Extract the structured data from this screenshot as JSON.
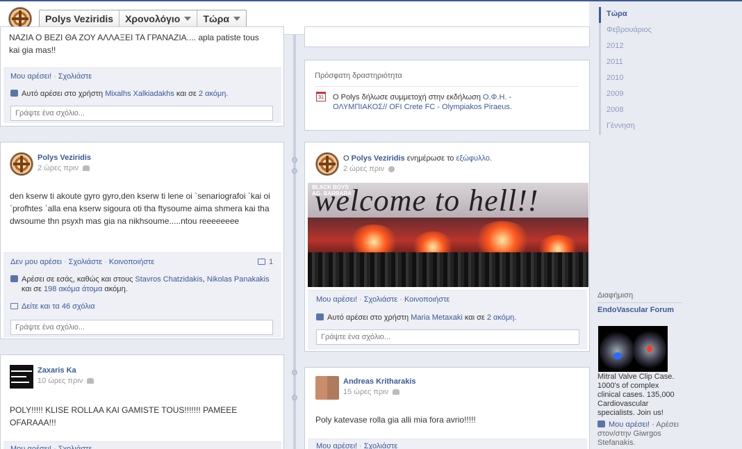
{
  "header": {
    "profile_name": "Polys Veziridis",
    "timeline_label": "Χρονολόγιο",
    "now_label": "Τώρα"
  },
  "common": {
    "like": "Μου αρέσει!",
    "unlike": "Δεν μου αρέσει",
    "comment": "Σχολιάστε",
    "share": "Κοινοποιήστε",
    "sep": "·",
    "comment_placeholder": "Γράψτε ένα σχόλιο..."
  },
  "post_top_left": {
    "text_line1": "NAZIA O BEZI ΘΑ ΖΟΥ ΑΛΛΑΞΕΙ ΤΑ ΓΡΑΝΑΖΙΑ.... apla patiste tous",
    "text_line2": "kai gia mas!!",
    "likes_prefix": "Αυτό αρέσει στο χρήστη",
    "likes_user": "Mixalhs Xalkiadakhs",
    "likes_and": "και σε",
    "likes_more": "2 ακόμη."
  },
  "recent_activity": {
    "title": "Πρόσφατη δραστηριότητα",
    "calendar_day": "31",
    "text_prefix": "Ο Polys δήλωσε συμμετοχή στην εκδήλωση",
    "event_line1": "Ο.Φ.Η. -",
    "event_line2": "ΟΛΥΜΠΙΑΚΟΣ// OFI Crete FC - Olympiakos Piraeus."
  },
  "post_polys": {
    "name": "Polys Veziridis",
    "time": "2 ώρες πριν",
    "text": "den kserw ti akoute gyro gyro,den kserw ti lene oi `senariografoi `kai oi `profhtes `alla ena kserw sigoura oti tha ftysoume aima shmera kai tha dwsoume thn psyxh mas gia na nikhsoume.....ntou reeeeeeee",
    "comment_count": "1",
    "likes_prefix": "Αρέσει σε εσάς, καθώς και στους",
    "likes_user1": "Stavros Chatzidakis",
    "likes_user2": "Nikolas Panakakis",
    "likes_line2_prefix": "και σε",
    "likes_more": "198 ακόμα άτομα",
    "likes_line2_suffix": "ακόμη.",
    "view_comments": "Δείτε και τα 46 σχόλια"
  },
  "post_cover": {
    "prefix": "Ο",
    "name": "Polys Veziridis",
    "action": "ενημέρωσε το",
    "cover": "εξώφυλλο.",
    "time": "2 ώρες πριν",
    "photo_caption": "welcome to hell!!",
    "photo_tag_line1": "BLACK BOYS",
    "photo_tag_line2": "AG. BARBARA",
    "likes_prefix": "Αυτό αρέσει στο χρήστη",
    "likes_user": "Maria Metaxaki",
    "likes_and": "και σε",
    "likes_more": "2 ακόμη."
  },
  "post_zaxaris": {
    "name": "Zaxaris Ka",
    "time": "10 ώρες πριν",
    "text": "POLY!!!!! KLISE ROLLAA KAI GAMISTE TOUS!!!!!!! PAMEEE OFARAAA!!!"
  },
  "post_andreas": {
    "name": "Andreas Kritharakis",
    "time": "15 ώρες πριν",
    "text": "Poly katevase rolla gia alli mia fora avrio!!!!!"
  },
  "years": [
    "Τώρα",
    "Φεβρουάριος",
    "2012",
    "2011",
    "2010",
    "2009",
    "2008",
    "Γέννηση"
  ],
  "ads": {
    "title": "Διαφήμιση",
    "headline": "EndoVascular Forum",
    "text": "Mitral Valve Clip Case. 1000's of complex clinical cases. 135,000 Cardiovascular specialists. Join us!",
    "like_label": "Μου αρέσει!",
    "like_suffix": "· Αρέσει στον/στην Giwrgos Stefanakis."
  }
}
